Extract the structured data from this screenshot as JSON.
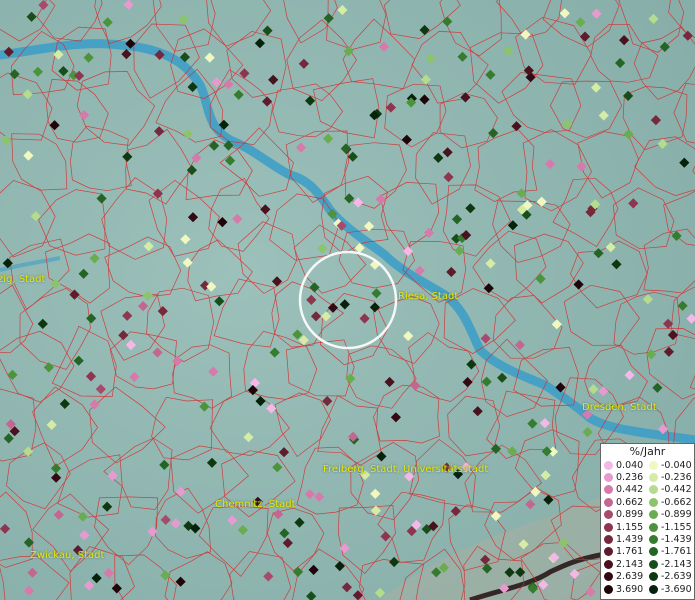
{
  "labels": [
    {
      "name": "label-leipzig",
      "text": "zig, Stadt"
    },
    {
      "name": "label-riesa",
      "text": "Riesa, Stadt"
    },
    {
      "name": "label-dresden",
      "text": "Dresden, Stadt"
    },
    {
      "name": "label-freiberg",
      "text": "Freiberg, Stadt, Universitätsstadt"
    },
    {
      "name": "label-chemnitz",
      "text": "Chemnitz, Stadt"
    },
    {
      "name": "label-zwickau",
      "text": "Zwickau, Stadt"
    }
  ],
  "legend": {
    "title": "%/Jahr",
    "positive": [
      {
        "value": "0.040",
        "color": "#f4b8e6"
      },
      {
        "value": "0.236",
        "color": "#e89ad0"
      },
      {
        "value": "0.442",
        "color": "#d67aac"
      },
      {
        "value": "0.662",
        "color": "#c26890"
      },
      {
        "value": "0.899",
        "color": "#a84a6c"
      },
      {
        "value": "1.155",
        "color": "#8e3550"
      },
      {
        "value": "1.439",
        "color": "#76283c"
      },
      {
        "value": "1.761",
        "color": "#5e1c2c"
      },
      {
        "value": "2.143",
        "color": "#48121e"
      },
      {
        "value": "2.639",
        "color": "#330a13"
      },
      {
        "value": "3.690",
        "color": "#1e050a"
      }
    ],
    "negative": [
      {
        "value": "-0.040",
        "color": "#f0f8c0"
      },
      {
        "value": "-0.236",
        "color": "#d4eca4"
      },
      {
        "value": "-0.442",
        "color": "#b4dc8c"
      },
      {
        "value": "-0.662",
        "color": "#8cc46c"
      },
      {
        "value": "-0.899",
        "color": "#6aac50"
      },
      {
        "value": "-1.155",
        "color": "#4c943c"
      },
      {
        "value": "-1.439",
        "color": "#367c2e"
      },
      {
        "value": "-1.761",
        "color": "#246424"
      },
      {
        "value": "-2.143",
        "color": "#184e1a"
      },
      {
        "value": "-2.639",
        "color": "#0e3810"
      },
      {
        "value": "-3.690",
        "color": "#06220a"
      }
    ]
  },
  "colors": {
    "background": "#8fb5b0",
    "river": "#3e9fc6",
    "boundaries": "#d62a2a",
    "label_text": "#e8e800",
    "highlight_ring": "#ffffff"
  }
}
